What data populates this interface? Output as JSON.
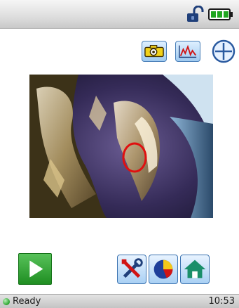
{
  "status_bar": {
    "status_text": "Ready",
    "time": "10:53"
  },
  "header": {
    "icons": [
      "unlocked-padlock-icon",
      "battery-full-icon"
    ]
  },
  "toolbar": {
    "icons": [
      "camera-snapshot-icon",
      "waveform-chart-icon",
      "crosshair-add-icon"
    ]
  },
  "bottom_bar": {
    "icons": [
      "play-icon",
      "tools-settings-icon",
      "pie-chart-icon",
      "home-icon"
    ]
  },
  "colors": {
    "accent": "#3a6fb0",
    "play_green": "#2ea032",
    "battery_green": "#1fa61f",
    "marker_red": "#e01010"
  }
}
